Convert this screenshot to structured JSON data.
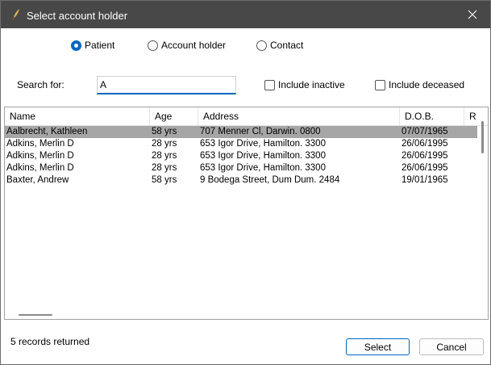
{
  "window": {
    "title": "Select account holder"
  },
  "radios": [
    {
      "label": "Patient",
      "checked": true
    },
    {
      "label": "Account holder",
      "checked": false
    },
    {
      "label": "Contact",
      "checked": false
    }
  ],
  "search": {
    "label": "Search for:",
    "value": "A"
  },
  "checkboxes": [
    {
      "label": "Include inactive",
      "checked": false
    },
    {
      "label": "Include deceased",
      "checked": false
    }
  ],
  "table": {
    "columns": [
      "Name",
      "Age",
      "Address",
      "D.O.B.",
      "R"
    ],
    "rows": [
      {
        "name": "Aalbrecht, Kathleen",
        "age": "58 yrs",
        "address": "707 Menner Cl, Darwin. 0800",
        "dob": "07/07/1965",
        "selected": true
      },
      {
        "name": "Adkins, Merlin D",
        "age": "28 yrs",
        "address": "653 Igor Drive, Hamilton. 3300",
        "dob": "26/06/1995",
        "selected": false
      },
      {
        "name": "Adkins, Merlin D",
        "age": "28 yrs",
        "address": "653 Igor Drive, Hamilton. 3300",
        "dob": "26/06/1995",
        "selected": false
      },
      {
        "name": "Adkins, Merlin D",
        "age": "28 yrs",
        "address": "653 Igor Drive, Hamilton. 3300",
        "dob": "26/06/1995",
        "selected": false
      },
      {
        "name": "Baxter, Andrew",
        "age": "58 yrs",
        "address": "9 Bodega Street, Dum Dum. 2484",
        "dob": "19/01/1965",
        "selected": false
      }
    ]
  },
  "status": {
    "text": "5 records returned"
  },
  "buttons": {
    "select": "Select",
    "cancel": "Cancel"
  },
  "icons": {
    "app": "quill-icon",
    "close": "close-icon"
  },
  "colors": {
    "titlebar": "#484848",
    "accent": "#0067c0",
    "selected_row": "#a6a6a6"
  }
}
